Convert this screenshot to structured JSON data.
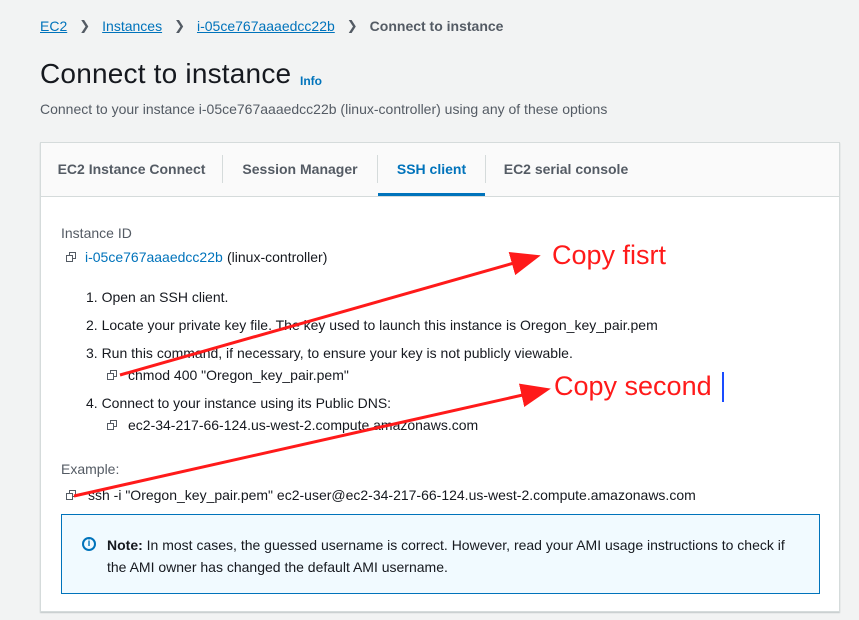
{
  "breadcrumb": {
    "items": [
      "EC2",
      "Instances",
      "i-05ce767aaaedcc22b"
    ],
    "current": "Connect to instance"
  },
  "header": {
    "title": "Connect to instance",
    "info": "Info",
    "description": "Connect to your instance i-05ce767aaaedcc22b (linux-controller) using any of these options"
  },
  "tabs": [
    {
      "label": "EC2 Instance Connect"
    },
    {
      "label": "Session Manager"
    },
    {
      "label": "SSH client",
      "active": true
    },
    {
      "label": "EC2 serial console"
    }
  ],
  "ssh": {
    "instance_id_label": "Instance ID",
    "instance_id": "i-05ce767aaaedcc22b",
    "instance_name": "(linux-controller)",
    "steps": [
      "1. Open an SSH client.",
      "2. Locate your private key file. The key used to launch this instance is Oregon_key_pair.pem",
      "3. Run this command, if necessary, to ensure your key is not publicly viewable.",
      "4. Connect to your instance using its Public DNS:"
    ],
    "chmod_command": "chmod 400 \"Oregon_key_pair.pem\"",
    "public_dns": "ec2-34-217-66-124.us-west-2.compute.amazonaws.com",
    "example_label": "Example:",
    "example_command": "ssh -i \"Oregon_key_pair.pem\" ec2-user@ec2-34-217-66-124.us-west-2.compute.amazonaws.com"
  },
  "note": {
    "bold": "Note:",
    "text": " In most cases, the guessed username is correct. However, read your AMI usage instructions to check if the AMI owner has changed the default AMI username."
  },
  "annotations": {
    "first": "Copy fisrt",
    "second": "Copy second",
    "color": "#ff1a1a"
  },
  "colors": {
    "link": "#0073bb",
    "background": "#f2f3f3",
    "note_bg": "#f1faff"
  }
}
